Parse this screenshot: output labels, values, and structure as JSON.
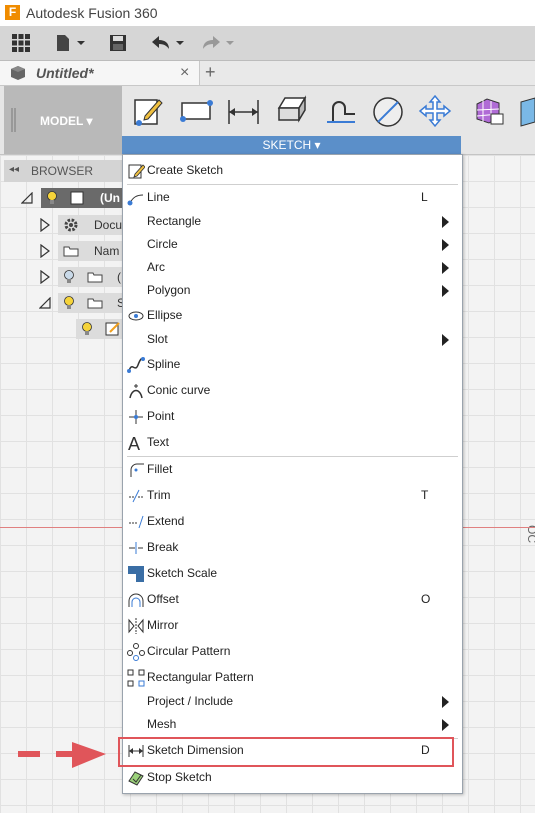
{
  "window": {
    "title": "Autodesk Fusion 360",
    "logo_letter": "F"
  },
  "tab": {
    "title": "Untitled*",
    "close": "×",
    "new_tab": "+"
  },
  "ribbon": {
    "workspace_label": "MODEL ▾",
    "sketch_label": "SKETCH ▾"
  },
  "browser": {
    "header": "BROWSER",
    "rows": [
      {
        "label": "(Un"
      },
      {
        "label": "Docu"
      },
      {
        "label": "Nam"
      },
      {
        "label": "("
      },
      {
        "label": "S"
      }
    ]
  },
  "menu": {
    "items": [
      {
        "label": "Create Sketch",
        "shortcut": "",
        "submenu": false,
        "icon": "create-sketch-icon"
      },
      {
        "label": "Line",
        "shortcut": "L",
        "submenu": false,
        "icon": "line-icon"
      },
      {
        "label": "Rectangle",
        "shortcut": "",
        "submenu": true,
        "icon": ""
      },
      {
        "label": "Circle",
        "shortcut": "",
        "submenu": true,
        "icon": ""
      },
      {
        "label": "Arc",
        "shortcut": "",
        "submenu": true,
        "icon": ""
      },
      {
        "label": "Polygon",
        "shortcut": "",
        "submenu": true,
        "icon": ""
      },
      {
        "label": "Ellipse",
        "shortcut": "",
        "submenu": false,
        "icon": "ellipse-icon"
      },
      {
        "label": "Slot",
        "shortcut": "",
        "submenu": true,
        "icon": ""
      },
      {
        "label": "Spline",
        "shortcut": "",
        "submenu": false,
        "icon": "spline-icon"
      },
      {
        "label": "Conic curve",
        "shortcut": "",
        "submenu": false,
        "icon": "conic-curve-icon"
      },
      {
        "label": "Point",
        "shortcut": "",
        "submenu": false,
        "icon": "point-icon"
      },
      {
        "label": "Text",
        "shortcut": "",
        "submenu": false,
        "icon": "text-icon"
      },
      {
        "label": "Fillet",
        "shortcut": "",
        "submenu": false,
        "icon": "fillet-icon"
      },
      {
        "label": "Trim",
        "shortcut": "T",
        "submenu": false,
        "icon": "trim-icon"
      },
      {
        "label": "Extend",
        "shortcut": "",
        "submenu": false,
        "icon": "extend-icon"
      },
      {
        "label": "Break",
        "shortcut": "",
        "submenu": false,
        "icon": "break-icon"
      },
      {
        "label": "Sketch Scale",
        "shortcut": "",
        "submenu": false,
        "icon": "sketch-scale-icon"
      },
      {
        "label": "Offset",
        "shortcut": "O",
        "submenu": false,
        "icon": "offset-icon"
      },
      {
        "label": "Mirror",
        "shortcut": "",
        "submenu": false,
        "icon": "mirror-icon"
      },
      {
        "label": "Circular Pattern",
        "shortcut": "",
        "submenu": false,
        "icon": "circular-pattern-icon"
      },
      {
        "label": "Rectangular Pattern",
        "shortcut": "",
        "submenu": false,
        "icon": "rectangular-pattern-icon"
      },
      {
        "label": "Project / Include",
        "shortcut": "",
        "submenu": true,
        "icon": ""
      },
      {
        "label": "Mesh",
        "shortcut": "",
        "submenu": true,
        "icon": ""
      },
      {
        "label": "Sketch Dimension",
        "shortcut": "D",
        "submenu": false,
        "icon": "sketch-dimension-icon"
      },
      {
        "label": "Stop Sketch",
        "shortcut": "",
        "submenu": false,
        "icon": "stop-sketch-icon"
      }
    ]
  },
  "canvas": {
    "side_label": "OC"
  },
  "colors": {
    "accent": "#5b8fc9",
    "highlight": "#e0555a",
    "logo": "#f08c00"
  }
}
